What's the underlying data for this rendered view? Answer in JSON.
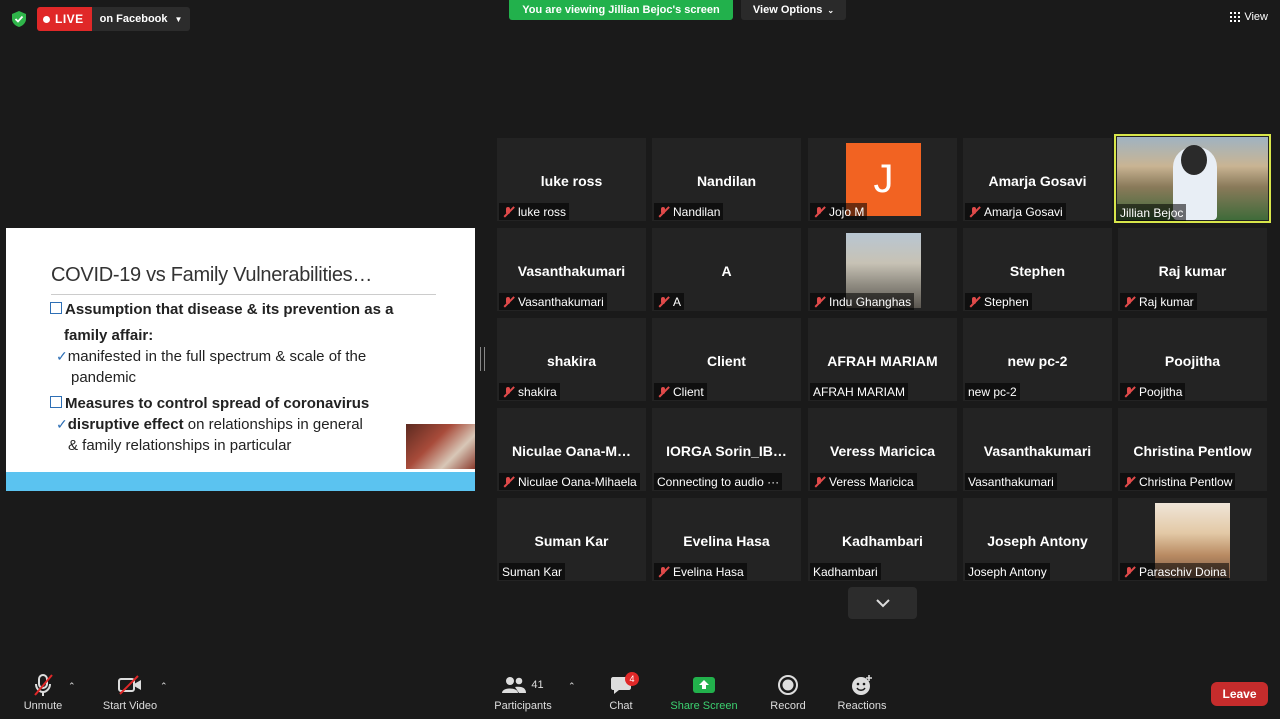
{
  "live": {
    "badge": "LIVE",
    "target": "on Facebook"
  },
  "banner": {
    "viewing": "You are viewing Jillian Bejoc's screen",
    "view_options": "View Options"
  },
  "view_button": "View",
  "slide": {
    "title": "COVID-19 vs Family Vulnerabilities…",
    "bullet1a": "Assumption that disease & its prevention as a",
    "bullet1b": "family affair:",
    "sub1a": "manifested in the full spectrum & scale of the",
    "sub1b": "pandemic",
    "bullet2": "Measures  to control spread of coronavirus",
    "sub2_bold": "disruptive effect",
    "sub2_rest": " on relationships in general",
    "sub2b": "& family relationships in particular"
  },
  "participants_grid": [
    {
      "name": "luke ross",
      "label": "luke ross",
      "muted": true
    },
    {
      "name": "Nandilan",
      "label": "Nandilan",
      "muted": true
    },
    {
      "name": "J",
      "label": "Jojo M",
      "muted": true,
      "avatar": "J"
    },
    {
      "name": "Amarja Gosavi",
      "label": "Amarja Gosavi",
      "muted": true
    },
    {
      "name": "",
      "label": "Jillian Bejoc",
      "muted": false,
      "video": true
    },
    {
      "name": "Vasanthakumari",
      "label": "Vasanthakumari",
      "muted": true
    },
    {
      "name": "A",
      "label": "A",
      "muted": true
    },
    {
      "name": "",
      "label": "Indu Ghanghas",
      "muted": true,
      "photo": true
    },
    {
      "name": "Stephen",
      "label": "Stephen",
      "muted": true
    },
    {
      "name": "Raj kumar",
      "label": "Raj kumar",
      "muted": true
    },
    {
      "name": "shakira",
      "label": "shakira",
      "muted": true
    },
    {
      "name": "Client",
      "label": "Client",
      "muted": true
    },
    {
      "name": "AFRAH MARIAM",
      "label": "AFRAH MARIAM",
      "muted": false
    },
    {
      "name": "new pc-2",
      "label": "new pc-2",
      "muted": false
    },
    {
      "name": "Poojitha",
      "label": "Poojitha",
      "muted": true
    },
    {
      "name": "Niculae  Oana-M…",
      "label": "Niculae Oana-Mihaela",
      "muted": true
    },
    {
      "name": "IORGA  Sorin_IB…",
      "label": "Connecting to audio ···",
      "muted": false
    },
    {
      "name": "Veress Maricica",
      "label": "Veress Maricica",
      "muted": true
    },
    {
      "name": "Vasanthakumari",
      "label": "Vasanthakumari",
      "muted": false
    },
    {
      "name": "Christina Pentlow",
      "label": "Christina Pentlow",
      "muted": true
    },
    {
      "name": "Suman Kar",
      "label": "Suman Kar",
      "muted": false
    },
    {
      "name": "Evelina Hasa",
      "label": "Evelina Hasa",
      "muted": true
    },
    {
      "name": "Kadhambari",
      "label": "Kadhambari",
      "muted": false
    },
    {
      "name": "Joseph Antony",
      "label": "Joseph Antony",
      "muted": false
    },
    {
      "name": "",
      "label": "Paraschiv Doina",
      "muted": true,
      "photo": true
    }
  ],
  "toolbar": {
    "unmute": "Unmute",
    "start_video": "Start Video",
    "participants": "Participants",
    "participants_count": "41",
    "chat": "Chat",
    "chat_badge": "4",
    "share_screen": "Share Screen",
    "record": "Record",
    "reactions": "Reactions",
    "leave": "Leave"
  },
  "colors": {
    "accent_green": "#22b14c",
    "live_red": "#e02828",
    "leave_red": "#c62c2c",
    "avatar_orange": "#f26322"
  }
}
